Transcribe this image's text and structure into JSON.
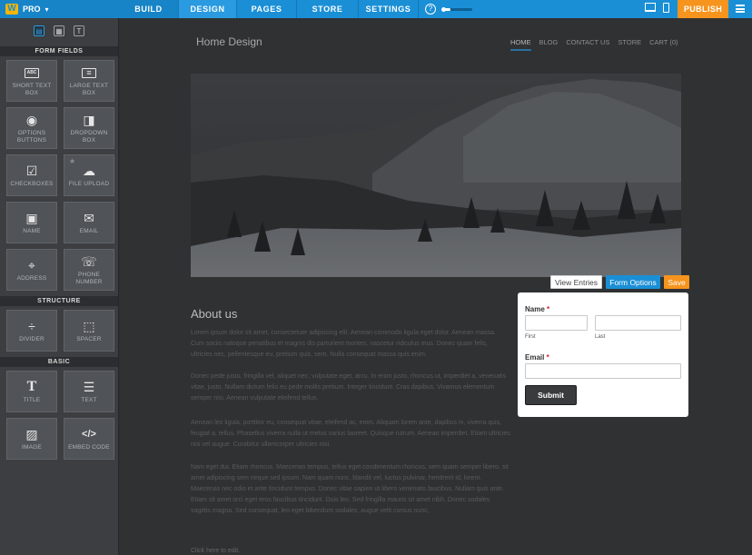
{
  "topbar": {
    "brand": "PRO",
    "tabs": [
      "BUILD",
      "DESIGN",
      "PAGES",
      "STORE",
      "SETTINGS"
    ],
    "active_tab": "BUILD",
    "help": "?",
    "publish": "PUBLISH",
    "accent": "#1a8fd6",
    "publish_color": "#f7941d",
    "progress": 0.25
  },
  "sidebar": {
    "form_fields_title": "FORM FIELDS",
    "form_fields": [
      {
        "label": "SHORT TEXT BOX",
        "icon": "short-text-icon",
        "glyph": "ABC"
      },
      {
        "label": "LARGE TEXT BOX",
        "icon": "large-text-icon",
        "glyph": "≡"
      },
      {
        "label": "OPTIONS BUTTONS",
        "icon": "radio-icon",
        "glyph": "◉"
      },
      {
        "label": "DROPDOWN BOX",
        "icon": "dropdown-icon",
        "glyph": "◨"
      },
      {
        "label": "CHECKBOXES",
        "icon": "checkbox-icon",
        "glyph": "☑"
      },
      {
        "label": "FILE UPLOAD",
        "icon": "cloud-upload-icon",
        "glyph": "☁"
      },
      {
        "label": "NAME",
        "icon": "name-card-icon",
        "glyph": "▣"
      },
      {
        "label": "EMAIL",
        "icon": "email-icon",
        "glyph": "✉"
      },
      {
        "label": "ADDRESS",
        "icon": "map-pin-icon",
        "glyph": "⌖"
      },
      {
        "label": "PHONE NUMBER",
        "icon": "phone-icon",
        "glyph": "☏"
      }
    ],
    "structure_title": "STRUCTURE",
    "structure": [
      {
        "label": "DIVIDER",
        "icon": "divider-icon",
        "glyph": "÷"
      },
      {
        "label": "SPACER",
        "icon": "spacer-icon",
        "glyph": "⬚"
      }
    ],
    "basic_title": "BASIC",
    "basic": [
      {
        "label": "TITLE",
        "icon": "title-icon",
        "glyph": "T"
      },
      {
        "label": "TEXT",
        "icon": "text-icon",
        "glyph": "☰"
      },
      {
        "label": "IMAGE",
        "icon": "image-icon",
        "glyph": "▨"
      },
      {
        "label": "EMBED CODE",
        "icon": "code-icon",
        "glyph": "</>"
      }
    ]
  },
  "site": {
    "title": "Home Design",
    "nav": [
      "HOME",
      "BLOG",
      "CONTACT US",
      "STORE",
      "CART (0)"
    ],
    "nav_active": "HOME",
    "about_heading": "About us",
    "paragraphs": [
      "Lorem ipsum dolor sit amet, consectetuer adipiscing elit. Aenean commodo ligula eget dolor. Aenean massa. Cum sociis natoque penatibus et magnis dis parturient montes, nascetur ridiculus mus. Donec quam felis, ultricies nec, pellentesque eu, pretium quis, sem. Nulla consequat massa quis enim.",
      "Donec pede justo, fringilla vel, aliquet nec, vulputate eget, arcu. In enim justo, rhoncus ut, imperdiet a, venenatis vitae, justo. Nullam dictum felis eu pede mollis pretium. Integer tincidunt. Cras dapibus. Vivamus elementum semper nisi. Aenean vulputate eleifend tellus.",
      "Aenean leo ligula, porttitor eu, consequat vitae, eleifend ac, enim. Aliquam lorem ante, dapibus in, viverra quis, feugiat a, tellus. Phasellus viverra nulla ut metus varius laoreet. Quisque rutrum. Aenean imperdiet. Etiam ultricies nisi vel augue. Curabitur ullamcorper ultricies nisi.",
      "Nam eget dui. Etiam rhoncus. Maecenas tempus, tellus eget condimentum rhoncus, sem quam semper libero, sit amet adipiscing sem neque sed ipsum. Nam quam nunc, blandit vel, luctus pulvinar, hendrerit id, lorem. Maecenas nec odio et ante tincidunt tempus. Donec vitae sapien ut libero venenatis faucibus. Nullam quis ante. Etiam sit amet orci eget eros faucibus tincidunt. Duis leo. Sed fringilla mauris sit amet nibh. Donec sodales sagittis magna. Sed consequat, leo eget bibendum sodales, augue velit cursus nunc,"
    ],
    "click_to_edit": "Click here to edit."
  },
  "form": {
    "view_entries": "View Entries",
    "form_options": "Form Options",
    "save": "Save",
    "name_label": "Name",
    "first_label": "First",
    "last_label": "Last",
    "email_label": "Email",
    "required_mark": "*",
    "submit": "Submit"
  }
}
